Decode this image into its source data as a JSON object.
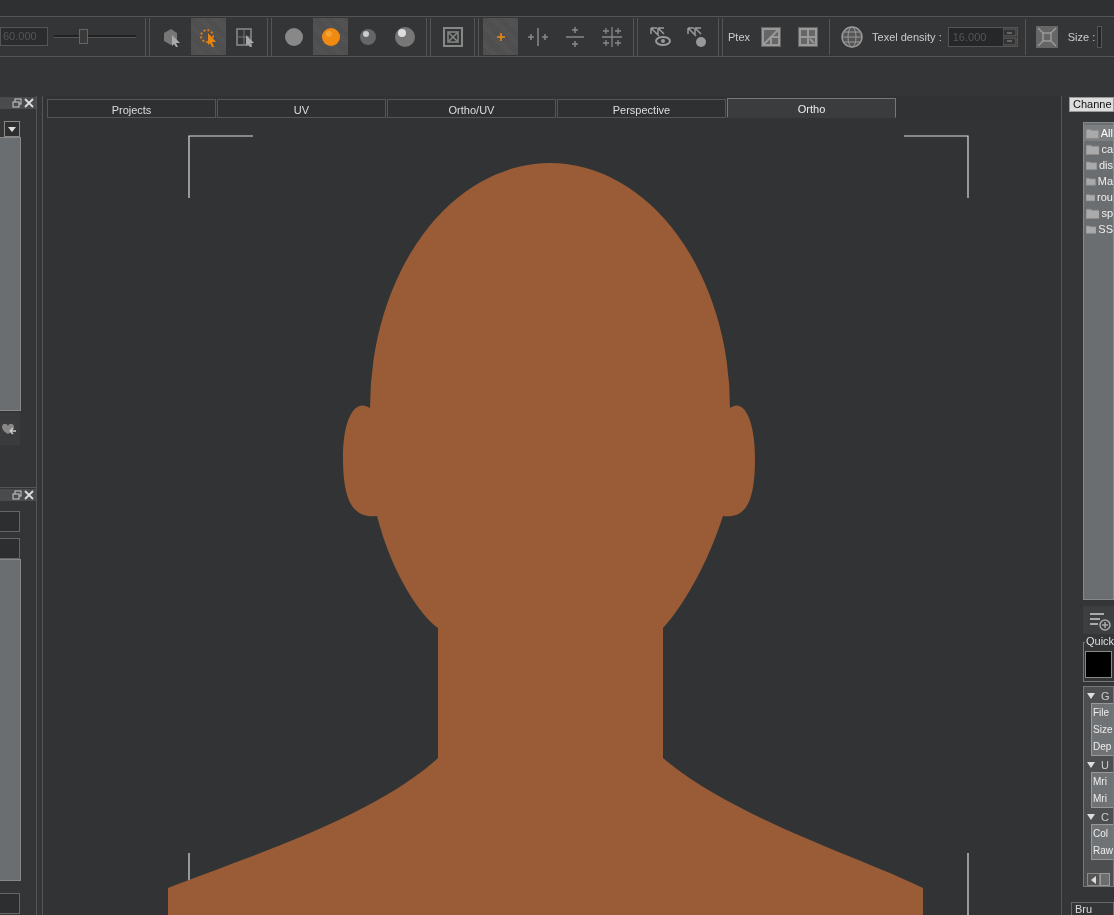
{
  "toolbar": {
    "value_field": "60.000",
    "slider": {
      "level": 0.35
    },
    "groups": [
      {
        "tools": [
          {
            "kind": "object-select",
            "selected": false
          },
          {
            "kind": "face-select",
            "selected": true
          },
          {
            "kind": "uv-select",
            "selected": false
          }
        ]
      },
      {
        "tools": [
          {
            "kind": "flat-shade",
            "selected": false
          },
          {
            "kind": "color-shade",
            "selected": true
          },
          {
            "kind": "metal-shade",
            "selected": false
          },
          {
            "kind": "gloss-shade",
            "selected": false
          }
        ]
      },
      {
        "tools": [
          {
            "kind": "frame-box",
            "selected": false
          }
        ]
      },
      {
        "tools": [
          {
            "kind": "sym-center",
            "selected": true
          },
          {
            "kind": "sym-x",
            "selected": false
          },
          {
            "kind": "sym-y",
            "selected": false
          },
          {
            "kind": "sym-xy",
            "selected": false
          }
        ]
      },
      {
        "tools": [
          {
            "kind": "eye-arrows",
            "selected": false
          },
          {
            "kind": "dot-arrows",
            "selected": false
          }
        ]
      }
    ],
    "ptex_label": "Ptex",
    "ptex_tools": [
      {
        "kind": "ptex-edit",
        "selected": false
      },
      {
        "kind": "ptex-split",
        "selected": false
      }
    ],
    "texel_density": {
      "label": "Texel density :",
      "value": "16.000"
    },
    "size_label": "Size :"
  },
  "tabs": [
    {
      "label": "Projects",
      "selected": false
    },
    {
      "label": "UV",
      "selected": false
    },
    {
      "label": "Ortho/UV",
      "selected": false
    },
    {
      "label": "Perspective",
      "selected": false
    },
    {
      "label": "Ortho",
      "selected": true
    }
  ],
  "right_panel": {
    "tab": "Channe",
    "channels": [
      {
        "name": "All",
        "selected": true
      },
      {
        "name": "ca",
        "selected": false
      },
      {
        "name": "dis",
        "selected": false
      },
      {
        "name": "Ma",
        "selected": false
      },
      {
        "name": "rou",
        "selected": false
      },
      {
        "name": "sp",
        "selected": false
      },
      {
        "name": "SS",
        "selected": false
      }
    ],
    "quick_label": "Quick",
    "sections": [
      {
        "title": "G",
        "rows": [
          "File",
          "Size",
          "Dep"
        ]
      },
      {
        "title": "U",
        "rows": [
          "Mri",
          "Mri"
        ]
      },
      {
        "title": "C",
        "rows": [
          "Col",
          "Raw"
        ]
      }
    ],
    "bottom_tab": "Bru"
  }
}
